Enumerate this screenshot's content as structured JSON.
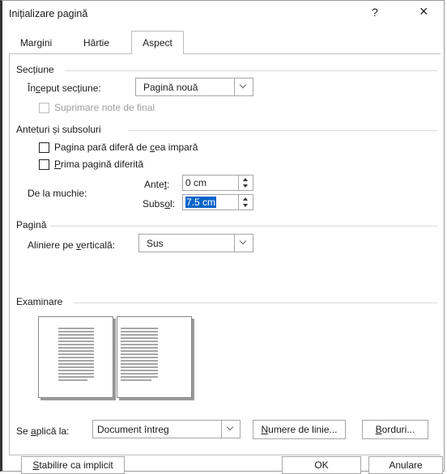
{
  "dialog": {
    "title": "Inițializare pagină",
    "help": "?",
    "close": "×"
  },
  "tabs": [
    {
      "label": "Margini",
      "active": false
    },
    {
      "label": "Hârtie",
      "active": false
    },
    {
      "label": "Aspect",
      "active": true
    }
  ],
  "section": {
    "heading": "Secțiune",
    "start_label_pre": "În",
    "start_label_u": "c",
    "start_label_post": "eput secțiune:",
    "start_value": "Pagină nouă",
    "suppress_endnotes": "Suprimare note de final"
  },
  "headers": {
    "heading": "Anteturi și subsoluri",
    "odd_even_pre": "Pagina pară diferă de ",
    "odd_even_u": "c",
    "odd_even_post": "ea impară",
    "first_page_u": "P",
    "first_page_post": "rima pagină diferită",
    "from_edge": "De la muchie:",
    "header_pre": "Ante",
    "header_u": "t",
    "header_post": ":",
    "header_value": "0 cm",
    "footer_pre": "Subs",
    "footer_u": "o",
    "footer_post": "l:",
    "footer_value": "7.5 cm"
  },
  "page": {
    "heading": "Pagină",
    "valign_pre": "Aliniere pe ",
    "valign_u": "v",
    "valign_post": "erticală:",
    "valign_value": "Sus"
  },
  "preview": {
    "heading": "Examinare"
  },
  "apply": {
    "label_pre": "Se ",
    "label_u": "a",
    "label_post": "plică la:",
    "value": "Document întreg",
    "line_numbers_u": "N",
    "line_numbers_post": "umere de linie...",
    "borders_u": "B",
    "borders_post": "orduri..."
  },
  "footer_buttons": {
    "default_u": "S",
    "default_post": "tabilire ca implicit",
    "ok": "OK",
    "cancel": "Anulare"
  }
}
